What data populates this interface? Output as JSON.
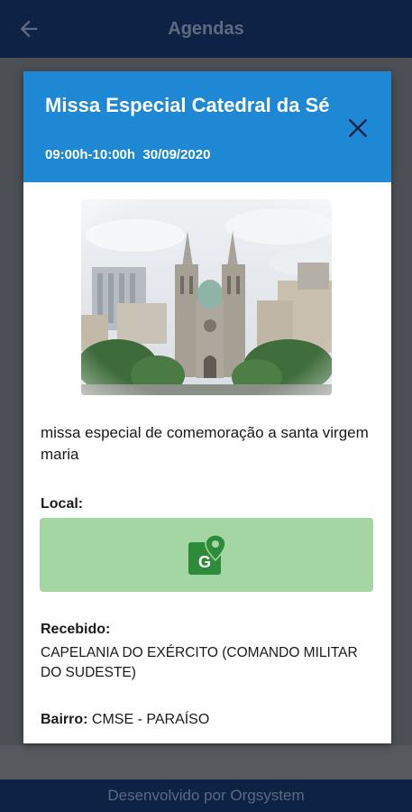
{
  "app": {
    "title": "Agendas",
    "footer": "Desenvolvido por Orgsystem"
  },
  "dialog": {
    "title": "Missa Especial Catedral da Sé",
    "time_date": "09:00h-10:00h  30/09/2020",
    "description": "missa especial de comemoração a santa virgem maria",
    "local_label": "Local:",
    "recebido_label": "Recebido:",
    "recebido_value": "CAPELANIA DO EXÉRCITO (COMANDO MILITAR DO SUDESTE)",
    "bairro_label": "Bairro:",
    "bairro_value": "CMSE - PARAÍSO"
  },
  "colors": {
    "header_blue": "#1e88d4",
    "appbar_navy": "#0d2244",
    "map_button_green": "#a3d6a2",
    "maps_icon_green": "#2e8b3a"
  },
  "icons": {
    "back": "arrow-back-icon",
    "close": "close-icon",
    "maps": "google-maps-icon"
  }
}
